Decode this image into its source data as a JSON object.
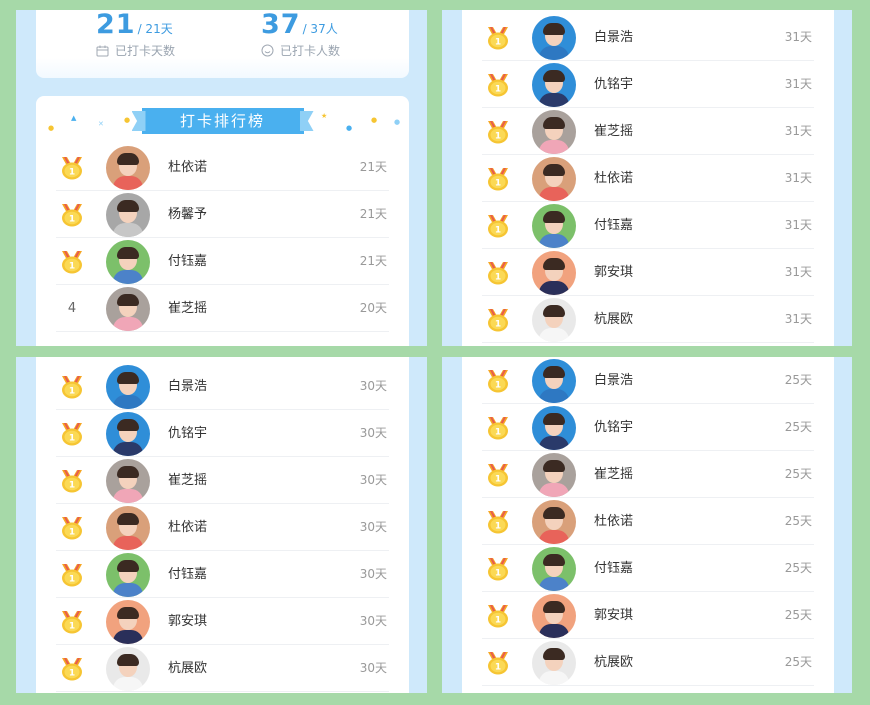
{
  "stats": {
    "days_value": "21",
    "days_total": "/ 21天",
    "days_label": "已打卡天数",
    "people_value": "37",
    "people_total": "/ 37人",
    "people_label": "已打卡人数"
  },
  "ranking_title": "打卡排行榜",
  "colors": {
    "accent": "#4ab0ef",
    "gold": "#f6c533",
    "panel_bg": "#cfe9fb",
    "page_bg": "#a6d9a8"
  },
  "panels": [
    {
      "rows": [
        {
          "rank": "",
          "medal": true,
          "name": "杜依诺",
          "days": "21天",
          "avatar_bg": "#d9a07a",
          "avatar_body": "#e8635a"
        },
        {
          "rank": "",
          "medal": true,
          "name": "杨馨予",
          "days": "21天",
          "avatar_bg": "#a7a7a7",
          "avatar_body": "#c7c7c7"
        },
        {
          "rank": "",
          "medal": true,
          "name": "付钰嘉",
          "days": "21天",
          "avatar_bg": "#7cc06a",
          "avatar_body": "#4c82c9"
        },
        {
          "rank": "4",
          "medal": false,
          "name": "崔芝摇",
          "days": "20天",
          "avatar_bg": "#a9a19c",
          "avatar_body": "#f0a6b7"
        }
      ]
    },
    {
      "rows": [
        {
          "rank": "",
          "medal": true,
          "name": "白景浩",
          "days": "31天",
          "avatar_bg": "#2f8ed8",
          "avatar_body": "#2e78c2"
        },
        {
          "rank": "",
          "medal": true,
          "name": "仇铭宇",
          "days": "31天",
          "avatar_bg": "#2f8ed8",
          "avatar_body": "#2a3a6a"
        },
        {
          "rank": "",
          "medal": true,
          "name": "崔芝摇",
          "days": "31天",
          "avatar_bg": "#a9a19c",
          "avatar_body": "#f0a6b7"
        },
        {
          "rank": "",
          "medal": true,
          "name": "杜依诺",
          "days": "31天",
          "avatar_bg": "#d9a07a",
          "avatar_body": "#e8635a"
        },
        {
          "rank": "",
          "medal": true,
          "name": "付钰嘉",
          "days": "31天",
          "avatar_bg": "#7cc06a",
          "avatar_body": "#4c82c9"
        },
        {
          "rank": "",
          "medal": true,
          "name": "郭安琪",
          "days": "31天",
          "avatar_bg": "#f1a27e",
          "avatar_body": "#2a2f5a"
        },
        {
          "rank": "",
          "medal": true,
          "name": "杭展欧",
          "days": "31天",
          "avatar_bg": "#e9e9e9",
          "avatar_body": "#f6f6f6"
        }
      ]
    },
    {
      "rows": [
        {
          "rank": "",
          "medal": true,
          "name": "白景浩",
          "days": "30天",
          "avatar_bg": "#2f8ed8",
          "avatar_body": "#2e78c2"
        },
        {
          "rank": "",
          "medal": true,
          "name": "仇铭宇",
          "days": "30天",
          "avatar_bg": "#2f8ed8",
          "avatar_body": "#2a3a6a"
        },
        {
          "rank": "",
          "medal": true,
          "name": "崔芝摇",
          "days": "30天",
          "avatar_bg": "#a9a19c",
          "avatar_body": "#f0a6b7"
        },
        {
          "rank": "",
          "medal": true,
          "name": "杜依诺",
          "days": "30天",
          "avatar_bg": "#d9a07a",
          "avatar_body": "#e8635a"
        },
        {
          "rank": "",
          "medal": true,
          "name": "付钰嘉",
          "days": "30天",
          "avatar_bg": "#7cc06a",
          "avatar_body": "#4c82c9"
        },
        {
          "rank": "",
          "medal": true,
          "name": "郭安琪",
          "days": "30天",
          "avatar_bg": "#f1a27e",
          "avatar_body": "#2a2f5a"
        },
        {
          "rank": "",
          "medal": true,
          "name": "杭展欧",
          "days": "30天",
          "avatar_bg": "#e9e9e9",
          "avatar_body": "#f6f6f6"
        }
      ]
    },
    {
      "rows": [
        {
          "rank": "",
          "medal": true,
          "name": "白景浩",
          "days": "25天",
          "avatar_bg": "#2f8ed8",
          "avatar_body": "#2e78c2"
        },
        {
          "rank": "",
          "medal": true,
          "name": "仇铭宇",
          "days": "25天",
          "avatar_bg": "#2f8ed8",
          "avatar_body": "#2a3a6a"
        },
        {
          "rank": "",
          "medal": true,
          "name": "崔芝摇",
          "days": "25天",
          "avatar_bg": "#a9a19c",
          "avatar_body": "#f0a6b7"
        },
        {
          "rank": "",
          "medal": true,
          "name": "杜依诺",
          "days": "25天",
          "avatar_bg": "#d9a07a",
          "avatar_body": "#e8635a"
        },
        {
          "rank": "",
          "medal": true,
          "name": "付钰嘉",
          "days": "25天",
          "avatar_bg": "#7cc06a",
          "avatar_body": "#4c82c9"
        },
        {
          "rank": "",
          "medal": true,
          "name": "郭安琪",
          "days": "25天",
          "avatar_bg": "#f1a27e",
          "avatar_body": "#2a2f5a"
        },
        {
          "rank": "",
          "medal": true,
          "name": "杭展欧",
          "days": "25天",
          "avatar_bg": "#e9e9e9",
          "avatar_body": "#f6f6f6"
        }
      ]
    }
  ]
}
